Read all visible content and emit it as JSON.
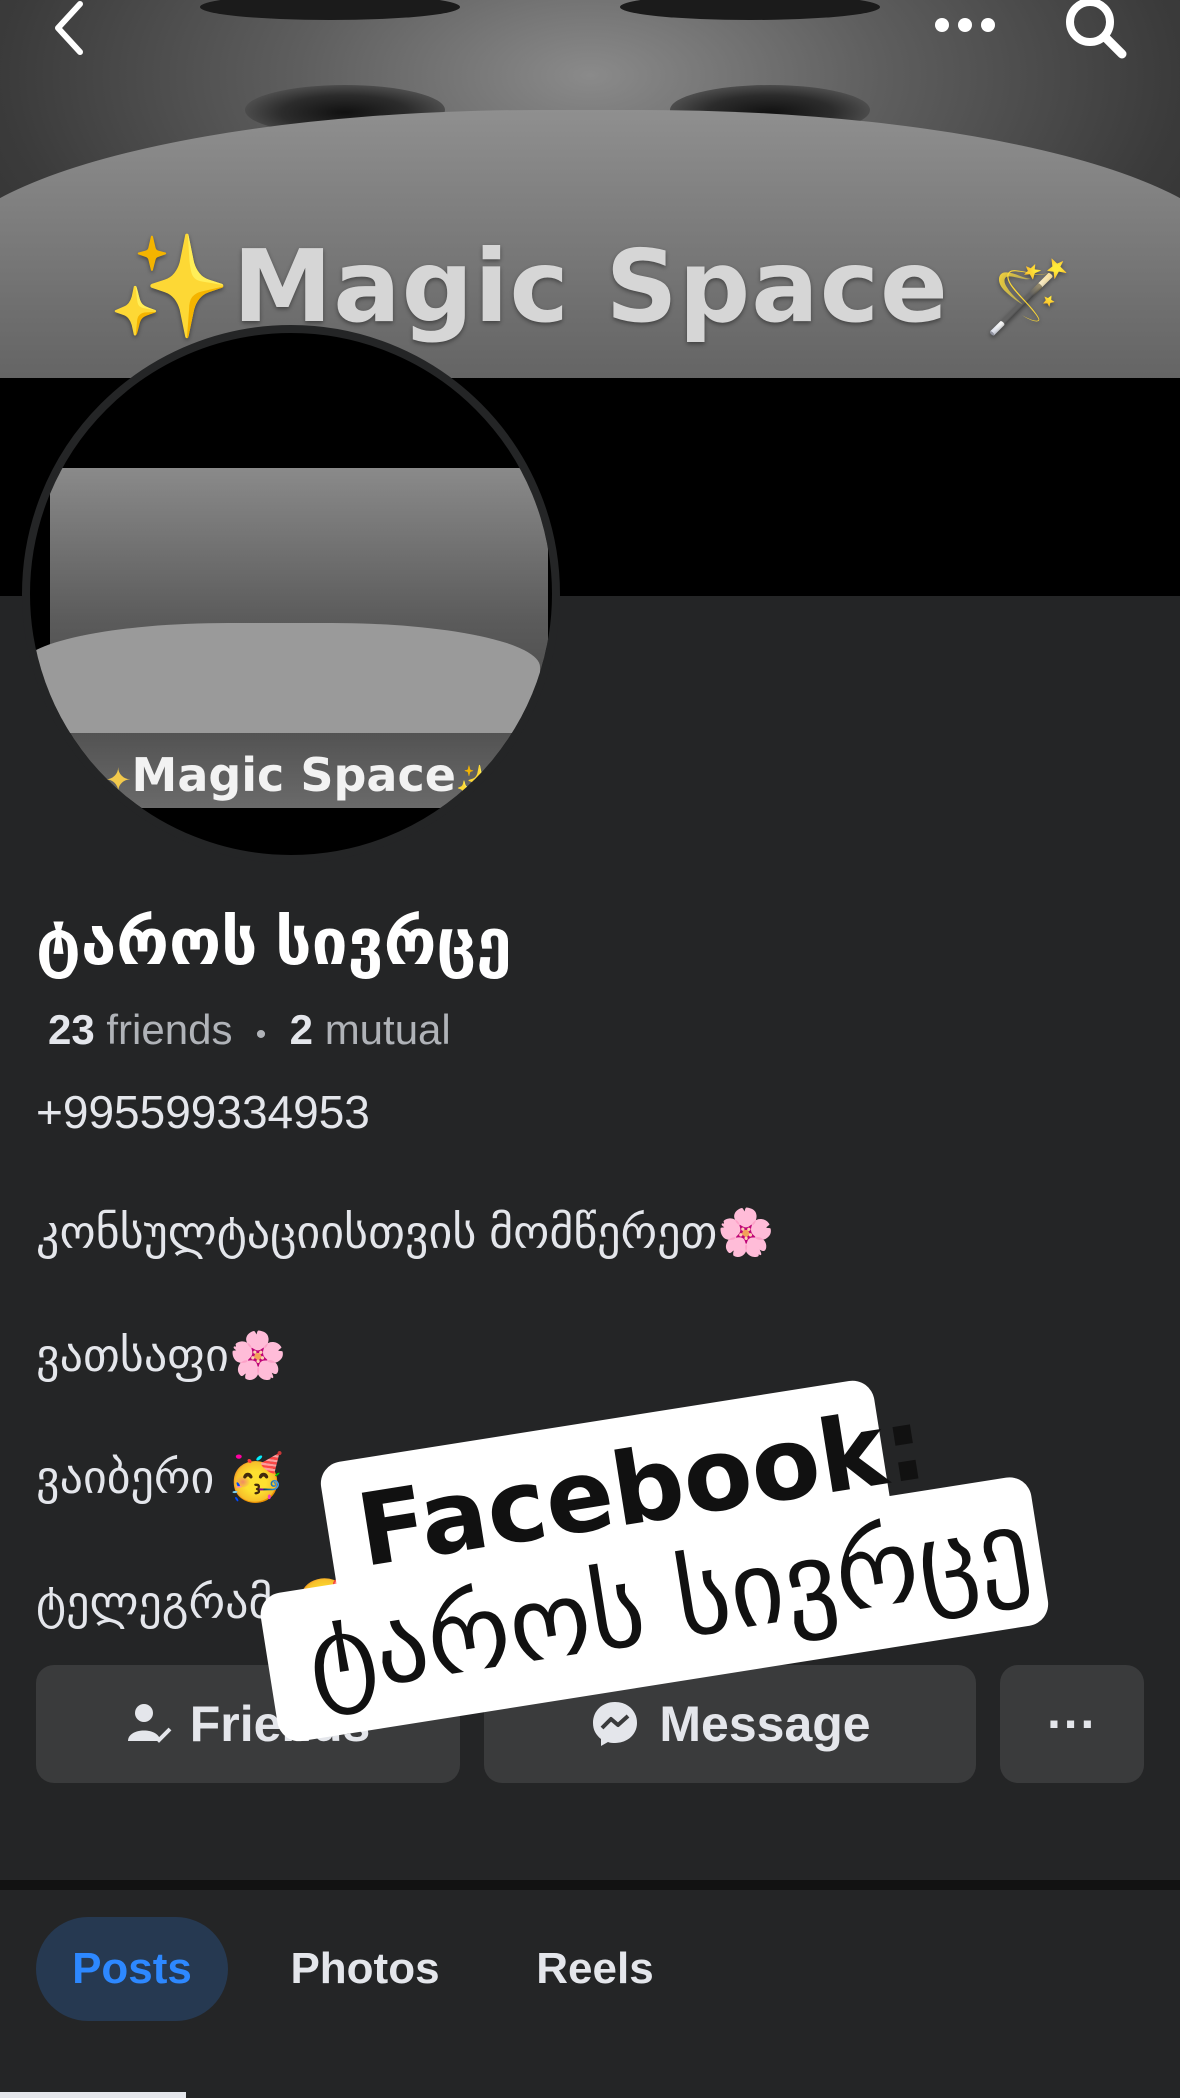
{
  "cover": {
    "title": "Magic Space",
    "sparkle": "✨",
    "wand": "🪄"
  },
  "nav": {
    "back_icon": "chevron-left-icon",
    "more_icon": "more-icon",
    "search_icon": "search-icon"
  },
  "avatar": {
    "text": "Magic Space",
    "sparkle": "✦",
    "wand": "✨"
  },
  "profile": {
    "name": "ტაროს სივრცე",
    "friends_count": "23",
    "friends_label": "friends",
    "separator": "•",
    "mutual_count": "2",
    "mutual_label": "mutual"
  },
  "bio": {
    "phone": "+995599334953",
    "line1": "კონსულტაციისთვის მომწერეთ🌸",
    "line2": "ვათსაფი🌸",
    "line3": "ვაიბერი 🥳",
    "line4": "ტელეგრამი🥰"
  },
  "actions": {
    "friends_label": "Friends",
    "message_label": "Message",
    "more_label": "···"
  },
  "tabs": [
    {
      "label": "Posts",
      "active": true
    },
    {
      "label": "Photos",
      "active": false
    },
    {
      "label": "Reels",
      "active": false
    }
  ],
  "overlay": {
    "line1": "Facebook:",
    "line2": "ტაროს სივრცე"
  },
  "colors": {
    "background": "#242526",
    "accent": "#2d88ff",
    "button": "#3a3b3c"
  }
}
